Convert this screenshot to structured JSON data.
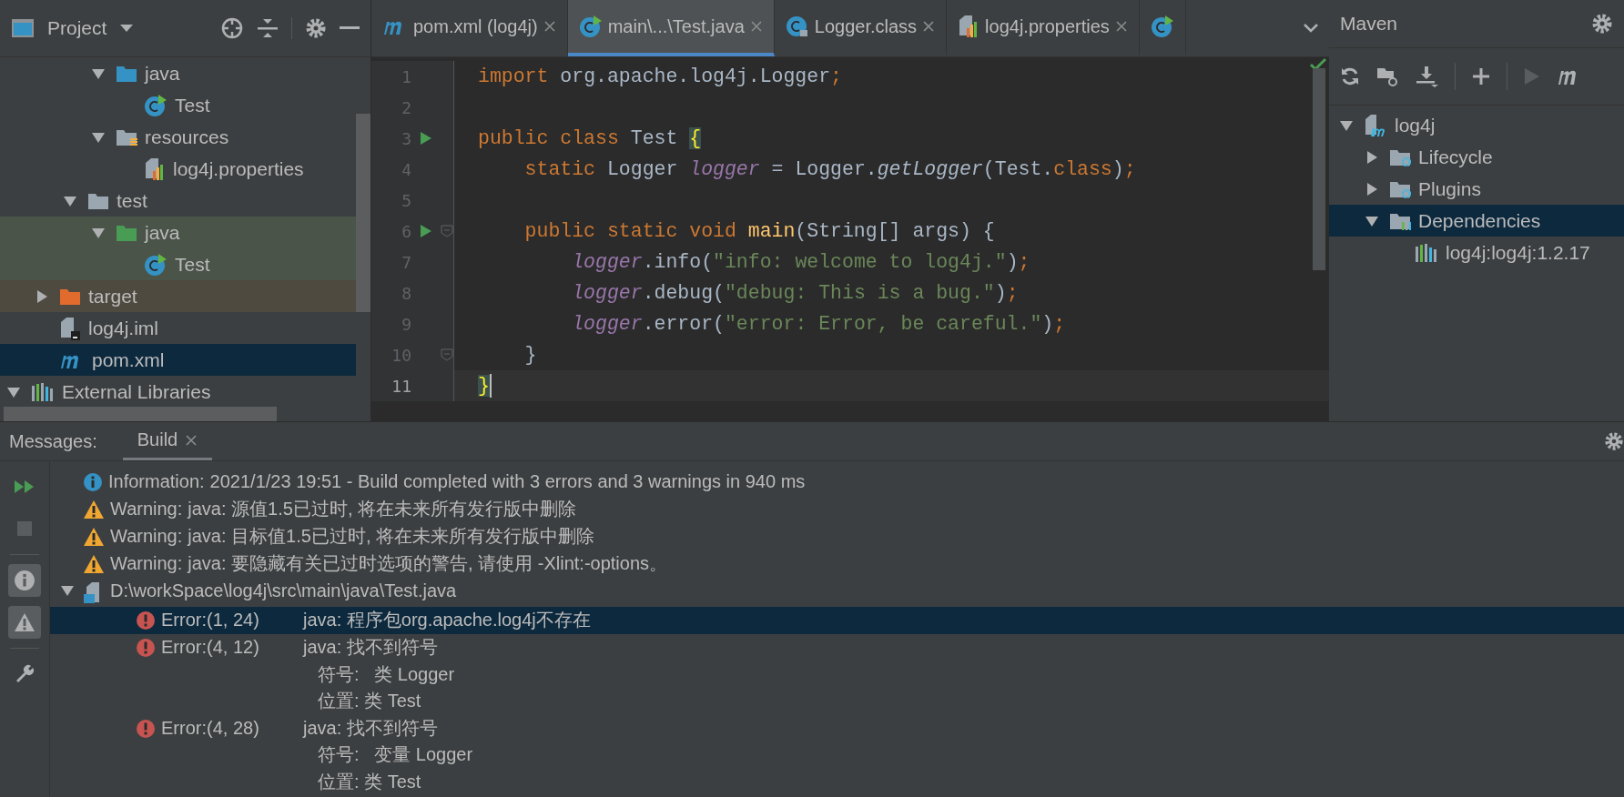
{
  "project_panel": {
    "title": "Project",
    "tree": [
      {
        "children": [
          {
            "children": [
              {
                "children": [
                  {
                    "label": "java",
                    "kind": "source_folder",
                    "expanded": true,
                    "selected": false,
                    "children": [
                      {
                        "label": "Test",
                        "kind": "class",
                        "selected": false
                      }
                    ]
                  },
                  {
                    "label": "resources",
                    "kind": "resources_folder",
                    "expanded": true,
                    "selected": false,
                    "children": [
                      {
                        "label": "log4j.properties",
                        "kind": "properties",
                        "selected": false
                      }
                    ]
                  }
                ]
              },
              {
                "label": "test",
                "kind": "folder",
                "expanded": true,
                "selected": false,
                "children": [
                  {
                    "label": "java",
                    "kind": "test_folder",
                    "expanded": true,
                    "selected": false,
                    "children": [
                      {
                        "label": "Test",
                        "kind": "test_class",
                        "selected": false
                      }
                    ]
                  }
                ]
              }
            ]
          },
          {
            "label": "target",
            "kind": "excluded_folder",
            "expanded": false,
            "selected": false
          },
          {
            "label": "log4j.iml",
            "kind": "iml",
            "selected": false
          },
          {
            "label": "pom.xml",
            "kind": "maven",
            "selected": true
          }
        ]
      },
      {
        "label": "External Libraries",
        "kind": "libraries",
        "expanded": true,
        "selected": false
      }
    ]
  },
  "editor": {
    "tabs": [
      {
        "label": "pom.xml (log4j)",
        "kind": "maven",
        "selected": false
      },
      {
        "label": "main\\...\\Test.java",
        "kind": "class",
        "selected": true
      },
      {
        "label": "Logger.class",
        "kind": "locked_class",
        "selected": false
      },
      {
        "label": "log4j.properties",
        "kind": "properties",
        "selected": false
      },
      {
        "kind": "class",
        "selected": false
      }
    ],
    "lines": [
      {
        "number": "1",
        "current": false,
        "tokens": [
          {
            "kind": "kw",
            "text": "import "
          },
          {
            "kind": "plain",
            "text": "org.apache.log4j.Logger"
          },
          {
            "kind": "kw",
            "text": ";"
          }
        ]
      },
      {
        "number": "2",
        "current": false
      },
      {
        "number": "3",
        "current": false,
        "run": true,
        "tokens": [
          {
            "kind": "kw",
            "text": "public class "
          },
          {
            "kind": "plain",
            "text": "Test "
          },
          {
            "kind": "brace",
            "text": "{"
          }
        ]
      },
      {
        "number": "4",
        "current": false,
        "tokens": [
          {
            "kind": "kw",
            "text": "    static "
          },
          {
            "kind": "plain",
            "text": "Logger "
          },
          {
            "kind": "field",
            "text": "logger"
          },
          {
            "kind": "plain",
            "text": " = Logger."
          },
          {
            "kind": "call",
            "text": "getLogger"
          },
          {
            "kind": "plain",
            "text": "(Test."
          },
          {
            "kind": "kw",
            "text": "class"
          },
          {
            "kind": "plain",
            "text": ")"
          },
          {
            "kind": "kw",
            "text": ";"
          }
        ]
      },
      {
        "number": "5",
        "current": false
      },
      {
        "number": "6",
        "current": false,
        "run": true,
        "fold": true,
        "tokens": [
          {
            "kind": "kw",
            "text": "    public static void "
          },
          {
            "kind": "fn",
            "text": "main"
          },
          {
            "kind": "plain",
            "text": "(String[] args) {"
          }
        ]
      },
      {
        "number": "7",
        "current": false,
        "tokens": [
          {
            "kind": "field",
            "text": "        logger"
          },
          {
            "kind": "plain",
            "text": ".info("
          },
          {
            "kind": "str",
            "text": "\"info: welcome to log4j.\""
          },
          {
            "kind": "plain",
            "text": ")"
          },
          {
            "kind": "kw",
            "text": ";"
          }
        ]
      },
      {
        "number": "8",
        "current": false,
        "tokens": [
          {
            "kind": "field",
            "text": "        logger"
          },
          {
            "kind": "plain",
            "text": ".debug("
          },
          {
            "kind": "str",
            "text": "\"debug: This is a bug.\""
          },
          {
            "kind": "plain",
            "text": ")"
          },
          {
            "kind": "kw",
            "text": ";"
          }
        ]
      },
      {
        "number": "9",
        "current": false,
        "tokens": [
          {
            "kind": "field",
            "text": "        logger"
          },
          {
            "kind": "plain",
            "text": ".error("
          },
          {
            "kind": "str",
            "text": "\"error: Error, be careful.\""
          },
          {
            "kind": "plain",
            "text": ")"
          },
          {
            "kind": "kw",
            "text": ";"
          }
        ]
      },
      {
        "number": "10",
        "current": false,
        "fold": true,
        "tokens": [
          {
            "kind": "plain",
            "text": "    }"
          }
        ]
      },
      {
        "number": "11",
        "current": true,
        "tokens": [
          {
            "kind": "brace",
            "text": "}"
          }
        ]
      }
    ]
  },
  "maven_panel": {
    "title": "Maven",
    "tree": [
      {
        "label": "log4j",
        "kind": "maven_module",
        "expanded": true,
        "selected": false,
        "children": [
          {
            "label": "Lifecycle",
            "kind": "gear_folder",
            "expanded": false,
            "selected": false
          },
          {
            "label": "Plugins",
            "kind": "gear_folder",
            "expanded": false,
            "selected": false
          },
          {
            "label": "Dependencies",
            "kind": "deps_folder",
            "expanded": true,
            "selected": true,
            "children": [
              {
                "label": "log4j:log4j:1.2.17",
                "kind": "libraries",
                "selected": false
              }
            ]
          }
        ]
      }
    ]
  },
  "messages": {
    "title": "Messages:",
    "tabs": [
      {
        "label": "Build",
        "selected": true
      }
    ],
    "toggles": [
      {
        "kind": "info",
        "on": true
      },
      {
        "kind": "warning",
        "on": true
      }
    ],
    "rows": [
      {
        "kind": "info",
        "label": "Information:",
        "lines": [
          "2021/1/23 19:51 - Build completed with 3 errors and 3 warnings in 940 ms"
        ],
        "selected": false
      },
      {
        "kind": "warning",
        "label": "Warning:",
        "lines": [
          "java: 源值1.5已过时, 将在未来所有发行版中删除"
        ],
        "selected": false
      },
      {
        "kind": "warning",
        "label": "Warning:",
        "lines": [
          "java: 目标值1.5已过时, 将在未来所有发行版中删除"
        ],
        "selected": false
      },
      {
        "kind": "warning",
        "label": "Warning:",
        "lines": [
          "java: 要隐藏有关已过时选项的警告, 请使用 -Xlint:-options。"
        ],
        "selected": false
      },
      {
        "kind": "file",
        "label": "D:\\workSpace\\log4j\\src\\main\\java\\Test.java",
        "expanded": true,
        "selected": false,
        "children": [
          {
            "kind": "error",
            "label": "Error:(1, 24)",
            "lines": [
              "java: 程序包org.apache.log4j不存在"
            ],
            "selected": true
          },
          {
            "kind": "error",
            "label": "Error:(4, 12)",
            "lines": [
              "java: 找不到符号",
              "符号:   类 Logger",
              "位置: 类 Test"
            ],
            "selected": false
          },
          {
            "kind": "error",
            "label": "Error:(4, 28)",
            "lines": [
              "java: 找不到符号",
              "符号:   变量 Logger",
              "位置: 类 Test"
            ],
            "selected": false
          }
        ]
      }
    ]
  }
}
